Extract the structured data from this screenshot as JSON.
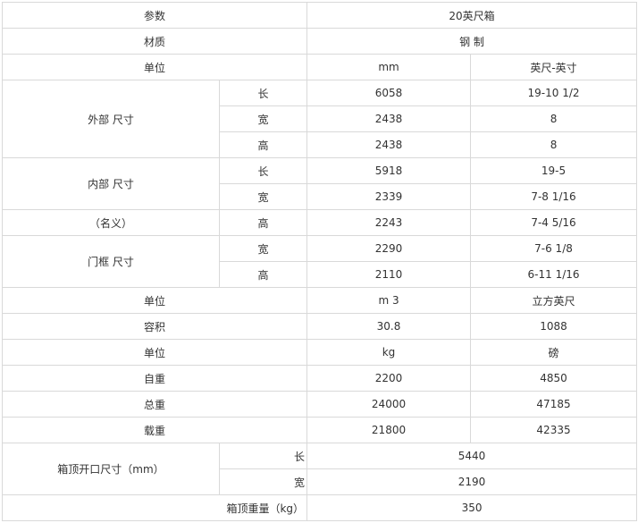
{
  "header": {
    "param": "参数",
    "container": "20英尺箱"
  },
  "material": {
    "label": "材质",
    "value": "钢 制"
  },
  "unit_row": {
    "label": "单位",
    "metric": "mm",
    "imperial": "英尺-英寸"
  },
  "external": {
    "label": "外部 尺寸",
    "rows": [
      {
        "dim": "长",
        "metric": "6058",
        "imperial": "19-10 1/2"
      },
      {
        "dim": "宽",
        "metric": "2438",
        "imperial": "8"
      },
      {
        "dim": "高",
        "metric": "2438",
        "imperial": "8"
      }
    ]
  },
  "internal": {
    "label": "内部 尺寸",
    "note": "（名义）",
    "rows": [
      {
        "dim": "长",
        "metric": "5918",
        "imperial": "19-5"
      },
      {
        "dim": "宽",
        "metric": "2339",
        "imperial": "7-8 1/16"
      },
      {
        "dim": "高",
        "metric": "2243",
        "imperial": "7-4 5/16"
      }
    ]
  },
  "door": {
    "label": "门框 尺寸",
    "rows": [
      {
        "dim": "宽",
        "metric": "2290",
        "imperial": "7-6 1/8"
      },
      {
        "dim": "高",
        "metric": "2110",
        "imperial": "6-11 1/16"
      }
    ]
  },
  "volume_unit": {
    "label": "单位",
    "metric": "m 3",
    "imperial": "立方英尺"
  },
  "volume": {
    "label": "容积",
    "metric": "30.8",
    "imperial": "1088"
  },
  "weight_unit": {
    "label": "单位",
    "metric": "kg",
    "imperial": "磅"
  },
  "tare": {
    "label": "自重",
    "metric": "2200",
    "imperial": "4850"
  },
  "gross": {
    "label": "总重",
    "metric": "24000",
    "imperial": "47185"
  },
  "payload": {
    "label": "载重",
    "metric": "21800",
    "imperial": "42335"
  },
  "roof_opening": {
    "label": "箱顶开口尺寸（mm）",
    "rows": [
      {
        "dim": "长",
        "value": "5440"
      },
      {
        "dim": "宽",
        "value": "2190"
      }
    ]
  },
  "roof_load": {
    "label": "箱顶重量（kg）",
    "value": "350"
  }
}
